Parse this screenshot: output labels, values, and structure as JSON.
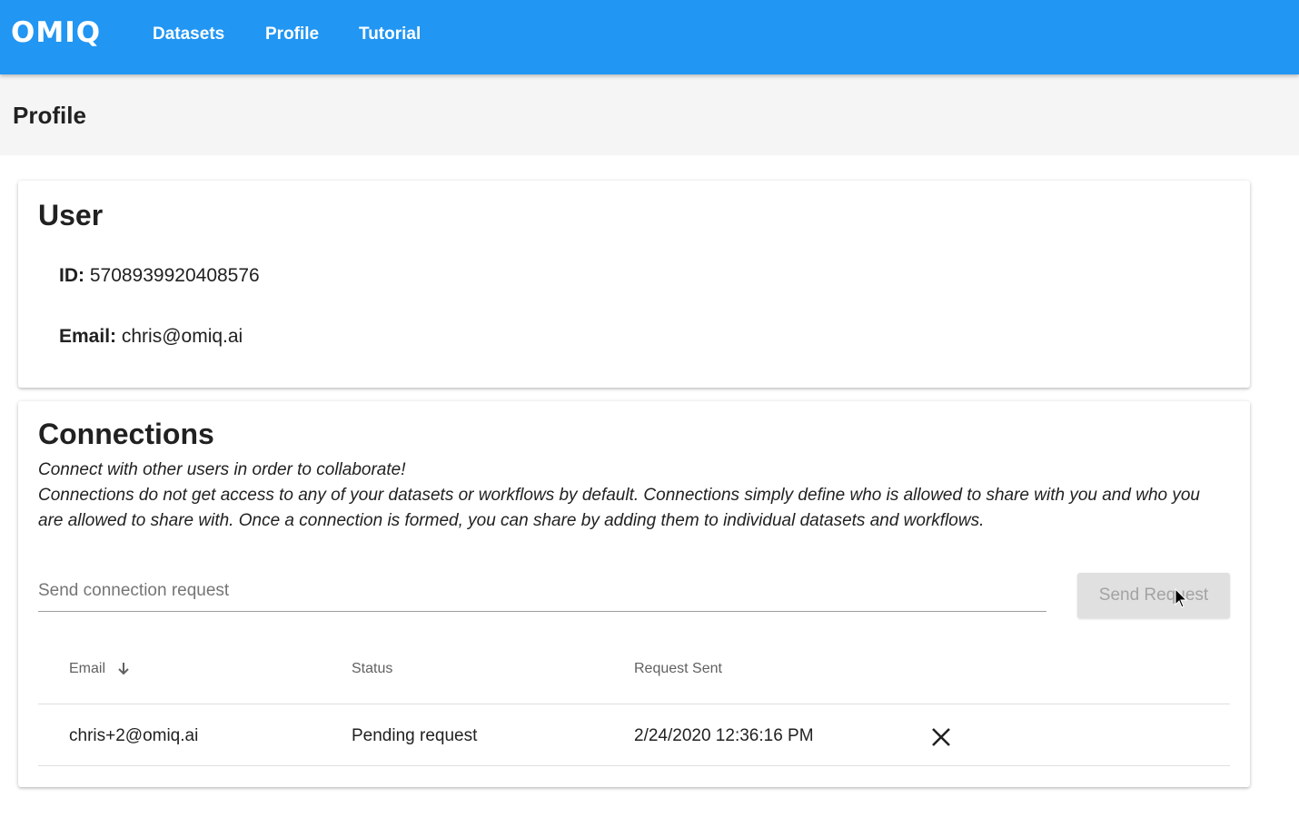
{
  "app": {
    "logo": "OMIQ",
    "nav": [
      "Datasets",
      "Profile",
      "Tutorial"
    ],
    "accent_color": "#2196f3"
  },
  "page": {
    "title": "Profile"
  },
  "user_card": {
    "title": "User",
    "id_label": "ID:",
    "id_value": "5708939920408576",
    "email_label": "Email:",
    "email_value": "chris@omiq.ai"
  },
  "connections": {
    "title": "Connections",
    "intro_line1": "Connect with other users in order to collaborate!",
    "intro_line2": "Connections do not get access to any of your datasets or workflows by default. Connections simply define who is allowed to share with you and who you are allowed to share with. Once a connection is formed, you can share by adding them to individual datasets and workflows.",
    "input_placeholder": "Send connection request",
    "input_value": "",
    "send_button": "Send Request",
    "table": {
      "columns": [
        "Email",
        "Status",
        "Request Sent"
      ],
      "sort_icon": "arrow-down-icon",
      "rows": [
        {
          "email": "chris+2@omiq.ai",
          "status": "Pending request",
          "sent": "2/24/2020 12:36:16 PM",
          "action_icon": "close-icon"
        }
      ]
    }
  }
}
